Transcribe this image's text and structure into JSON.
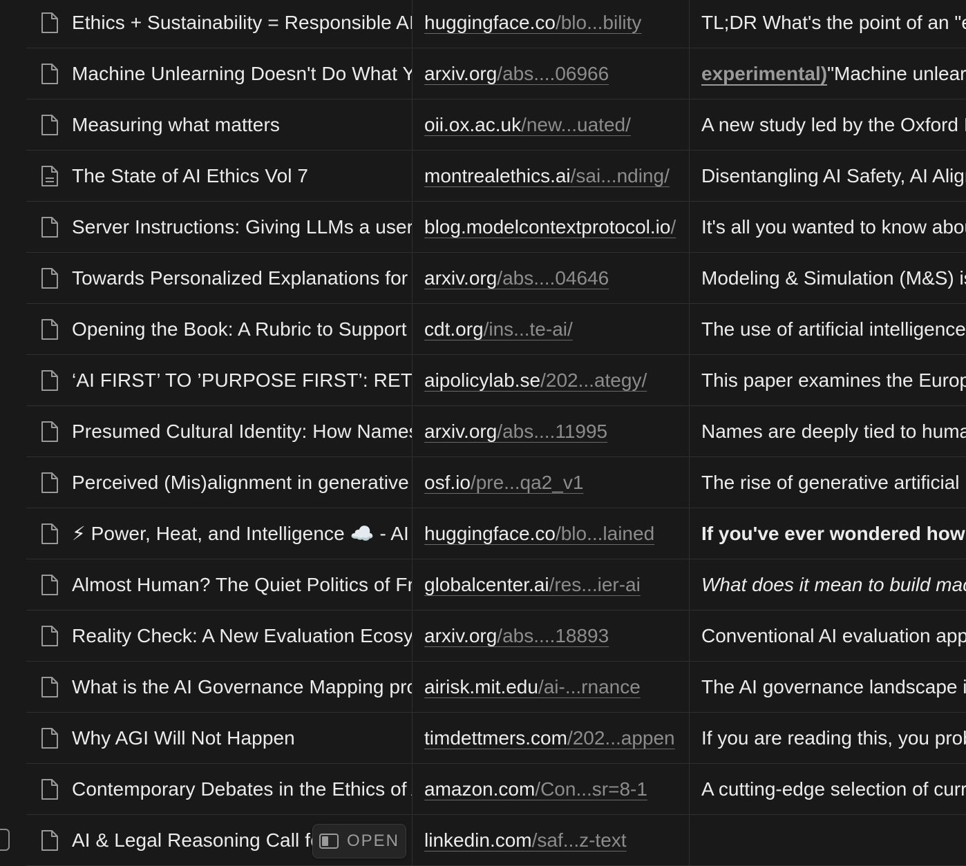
{
  "rows": [
    {
      "title": "Ethics + Sustainability = Responsible AI",
      "icon": "page-icon",
      "url_domain": "huggingface.co",
      "url_path": "/blo...bility",
      "desc": "TL;DR What's the point of an \"ethical\" AI",
      "desc_style": "normal"
    },
    {
      "title": "Machine Unlearning Doesn't Do What You Think",
      "icon": "page-icon",
      "url_domain": "arxiv.org",
      "url_path": "/abs....06966",
      "desc_prefix": "experimental)",
      "desc": "\"Machine unlearning",
      "desc_style": "prefixed"
    },
    {
      "title": "Measuring what matters",
      "icon": "page-icon",
      "url_domain": "oii.ox.ac.uk",
      "url_path": "/new...uated/",
      "desc": "A new study led by the Oxford Internet",
      "desc_style": "normal"
    },
    {
      "title": "The State of AI Ethics Vol 7",
      "icon": "page-text-icon",
      "url_domain": "montrealethics.ai",
      "url_path": "/sai...nding/",
      "desc": "Disentangling AI Safety, AI Alignment",
      "desc_style": "normal"
    },
    {
      "title": "Server Instructions: Giving LLMs a user manual",
      "icon": "page-icon",
      "url_domain": "blog.modelcontextprotocol.io",
      "url_path": "/",
      "desc": "It's all you wanted to know about",
      "desc_style": "normal"
    },
    {
      "title": "Towards Personalized Explanations for AI",
      "icon": "page-icon",
      "url_domain": "arxiv.org",
      "url_path": "/abs....04646",
      "desc": "Modeling & Simulation (M&S) is",
      "desc_style": "normal"
    },
    {
      "title": "Opening the Book: A Rubric to Support",
      "icon": "page-icon",
      "url_domain": "cdt.org",
      "url_path": "/ins...te-ai/",
      "desc": "The use of artificial intelligence",
      "desc_style": "normal"
    },
    {
      "title": "‘AI FIRST’ TO ’PURPOSE FIRST’: RETHINKING",
      "icon": "page-icon",
      "url_domain": "aipolicylab.se",
      "url_path": "/202...ategy/",
      "desc": "This paper examines the European",
      "desc_style": "normal"
    },
    {
      "title": "Presumed Cultural Identity: How Names",
      "icon": "page-icon",
      "url_domain": "arxiv.org",
      "url_path": "/abs....11995",
      "desc": "Names are deeply tied to human",
      "desc_style": "normal"
    },
    {
      "title": "Perceived (Mis)alignment in generative AI",
      "icon": "page-icon",
      "url_domain": "osf.io",
      "url_path": "/pre...qa2_v1",
      "desc": "The rise of generative artificial",
      "desc_style": "normal"
    },
    {
      "title": "⚡ Power, Heat, and Intelligence ☁️ - AI",
      "icon": "page-icon",
      "url_domain": "huggingface.co",
      "url_path": "/blo...lained",
      "desc": "If you've ever wondered how",
      "desc_style": "bold"
    },
    {
      "title": "Almost Human? The Quiet Politics of Frontier AI",
      "icon": "page-icon",
      "url_domain": "globalcenter.ai",
      "url_path": "/res...ier-ai",
      "desc": "What does it mean to build machines",
      "desc_style": "italic"
    },
    {
      "title": "Reality Check: A New Evaluation Ecosystem",
      "icon": "page-icon",
      "url_domain": "arxiv.org",
      "url_path": "/abs....18893",
      "desc": "Conventional AI evaluation approaches",
      "desc_style": "normal"
    },
    {
      "title": "What is the AI Governance Mapping project",
      "icon": "page-icon",
      "url_domain": "airisk.mit.edu",
      "url_path": "/ai-...rnance",
      "desc": "The AI governance landscape is",
      "desc_style": "normal"
    },
    {
      "title": "Why AGI Will Not Happen",
      "icon": "page-icon",
      "url_domain": "timdettmers.com",
      "url_path": "/202...appen",
      "desc": "If you are reading this, you probably",
      "desc_style": "normal"
    },
    {
      "title": "Contemporary Debates in the Ethics of AI",
      "icon": "page-icon",
      "url_domain": "amazon.com",
      "url_path": "/Con...sr=8-1",
      "desc": "A cutting-edge selection of current",
      "desc_style": "normal"
    },
    {
      "title": "AI & Legal Reasoning Call for Papers",
      "icon": "page-icon",
      "url_domain": "linkedin.com",
      "url_path": "/saf...z-text",
      "desc": "",
      "desc_style": "normal",
      "hovered": true
    }
  ],
  "open_button": {
    "label": "OPEN",
    "icon": "side-peek-icon"
  }
}
